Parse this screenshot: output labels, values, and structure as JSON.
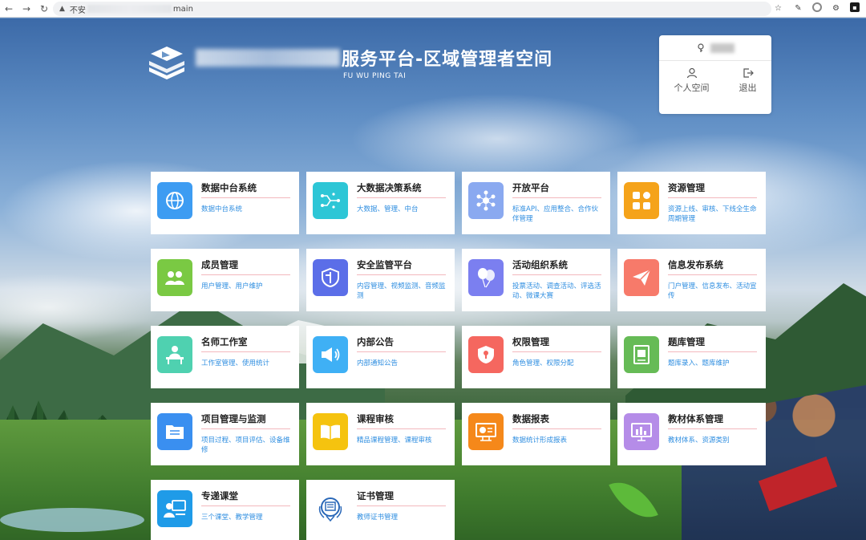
{
  "browser": {
    "security": "不安",
    "url_suffix": "main"
  },
  "header": {
    "title_visible": "服务平台-区域管理者空间",
    "subtitle": "FU WU PING TAI"
  },
  "user_panel": {
    "personal_label": "个人空间",
    "logout_label": "退出"
  },
  "colors": {
    "accent_desc": "#2f8ee0",
    "title_underline": "#f3b8bd"
  },
  "cards": [
    {
      "title": "数据中台系统",
      "desc": "数据中台系统",
      "color": "#3d9cf2",
      "icon": "globe-icon"
    },
    {
      "title": "大数据决策系统",
      "desc": "大数据、管理、中台",
      "color": "#2dc6d6",
      "icon": "circuit-icon"
    },
    {
      "title": "开放平台",
      "desc": "标准API、应用整合、合作伙伴管理",
      "color": "#8aa9f0",
      "icon": "network-icon"
    },
    {
      "title": "资源管理",
      "desc": "资源上线、审核、下线全生命周期管理",
      "color": "#f5a31a",
      "icon": "apps-grid-icon"
    },
    {
      "title": "成员管理",
      "desc": "用户管理、用户维护",
      "color": "#7ac943",
      "icon": "users-icon"
    },
    {
      "title": "安全监管平台",
      "desc": "内容管理、视频监测、音频监测",
      "color": "#5b6ee8",
      "icon": "shield-icon"
    },
    {
      "title": "活动组织系统",
      "desc": "投票活动、调查活动、评选活动、微课大赛",
      "color": "#7b7ff0",
      "icon": "balloons-icon"
    },
    {
      "title": "信息发布系统",
      "desc": "门户管理、信息发布、活动宣传",
      "color": "#f77a6a",
      "icon": "paper-plane-icon"
    },
    {
      "title": "名师工作室",
      "desc": "工作室管理、使用统计",
      "color": "#4fd1b0",
      "icon": "teacher-desk-icon"
    },
    {
      "title": "内部公告",
      "desc": "内部通知公告",
      "color": "#3fb0f5",
      "icon": "megaphone-icon"
    },
    {
      "title": "权限管理",
      "desc": "角色管理、权限分配",
      "color": "#f5675f",
      "icon": "lock-shield-icon"
    },
    {
      "title": "题库管理",
      "desc": "题库录入、题库维护",
      "color": "#66bb56",
      "icon": "question-book-icon"
    },
    {
      "title": "项目管理与监测",
      "desc": "项目过程、项目评估、设备维修",
      "color": "#3a8ff0",
      "icon": "folder-list-icon"
    },
    {
      "title": "课程审核",
      "desc": "精品课程管理、课程审核",
      "color": "#f5c30f",
      "icon": "open-book-icon"
    },
    {
      "title": "数据报表",
      "desc": "数据统计形成报表",
      "color": "#f5881a",
      "icon": "report-screen-icon"
    },
    {
      "title": "教材体系管理",
      "desc": "教材体系、资源类别",
      "color": "#b58ce8",
      "icon": "chart-screen-icon"
    },
    {
      "title": "专递课堂",
      "desc": "三个课堂、教学管理",
      "color": "#1f9be8",
      "icon": "classroom-icon"
    },
    {
      "title": "证书管理",
      "desc": "教师证书管理",
      "color": "#ffffff",
      "icon": "certificate-icon"
    }
  ]
}
